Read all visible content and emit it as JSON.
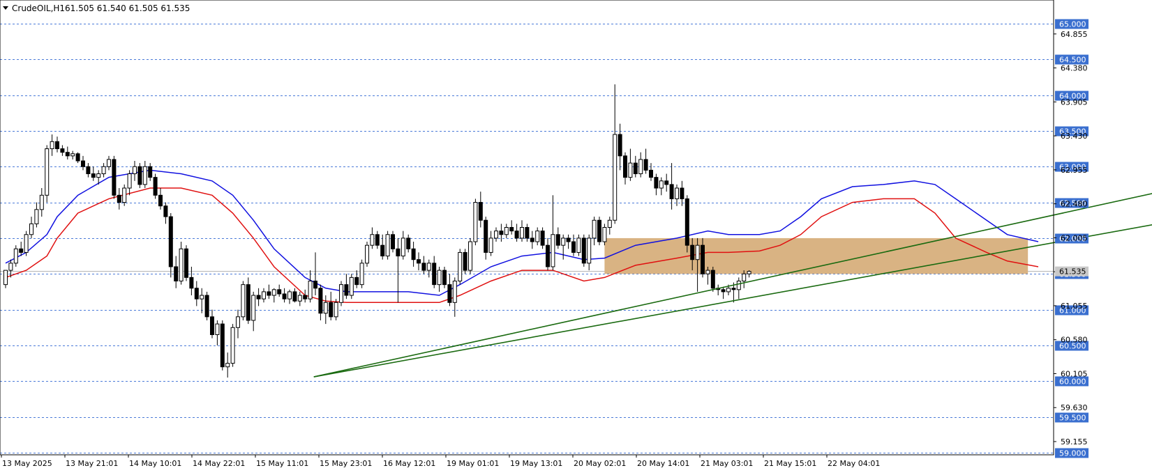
{
  "header": {
    "symbol_title": "CrudeOIL,H1",
    "ohlc": "61.505 61.540 61.505 61.535",
    "menu_icon": "triangle-down-icon"
  },
  "colors": {
    "background": "#ffffff",
    "grid_dashed": "#4a7ad8",
    "candle_up_fill": "#ffffff",
    "candle_down_fill": "#000000",
    "candle_outline": "#000000",
    "ma_fast": "#1010e0",
    "ma_slow": "#e01010",
    "trendline": "#1a6a10",
    "zone_fill": "#d9b383",
    "level_label_bg": "#3a6fcf",
    "price_tag_bg": "#c8c8c8"
  },
  "chart_data": {
    "type": "candlestick",
    "symbol": "CrudeOIL",
    "timeframe": "H1",
    "ylim": [
      58.97,
      65.33
    ],
    "price_axis_ticks": [
      "64.855",
      "64.380",
      "63.905",
      "63.430",
      "62.955",
      "62.480",
      "62.005",
      "61.530",
      "61.055",
      "60.580",
      "60.105",
      "59.630",
      "59.155"
    ],
    "levels": [
      "65.000",
      "64.500",
      "64.000",
      "63.500",
      "63.000",
      "62.500",
      "62.000",
      "61.500",
      "61.000",
      "60.500",
      "60.000",
      "59.500",
      "59.000"
    ],
    "current_price_tag": "61.535",
    "time_labels": [
      "13 May 2025",
      "13 May 21:01",
      "14 May 10:01",
      "14 May 22:01",
      "15 May 11:01",
      "15 May 23:01",
      "16 May 12:01",
      "19 May 01:01",
      "19 May 13:01",
      "20 May 02:01",
      "20 May 14:01",
      "21 May 03:01",
      "21 May 15:01",
      "22 May 04:01"
    ],
    "candles": [
      [
        61.35,
        61.55,
        61.3,
        61.55
      ],
      [
        61.55,
        61.7,
        61.45,
        61.65
      ],
      [
        61.65,
        61.9,
        61.6,
        61.85
      ],
      [
        61.85,
        61.95,
        61.75,
        61.8
      ],
      [
        61.8,
        62.1,
        61.75,
        62.05
      ],
      [
        62.05,
        62.3,
        62.0,
        62.2
      ],
      [
        62.2,
        62.5,
        62.15,
        62.4
      ],
      [
        62.4,
        62.7,
        62.3,
        62.6
      ],
      [
        62.6,
        63.3,
        62.5,
        63.25
      ],
      [
        63.25,
        63.45,
        63.15,
        63.35
      ],
      [
        63.35,
        63.42,
        63.2,
        63.25
      ],
      [
        63.25,
        63.3,
        63.15,
        63.2
      ],
      [
        63.2,
        63.28,
        63.1,
        63.15
      ],
      [
        63.15,
        63.22,
        63.1,
        63.18
      ],
      [
        63.18,
        63.2,
        63.05,
        63.08
      ],
      [
        63.08,
        63.15,
        62.95,
        63.0
      ],
      [
        63.0,
        63.05,
        62.85,
        62.9
      ],
      [
        62.9,
        63.0,
        62.8,
        62.85
      ],
      [
        62.85,
        62.95,
        62.75,
        62.9
      ],
      [
        62.9,
        63.05,
        62.85,
        63.0
      ],
      [
        63.0,
        63.15,
        62.95,
        63.1
      ],
      [
        63.1,
        63.15,
        62.55,
        62.6
      ],
      [
        62.6,
        62.7,
        62.4,
        62.5
      ],
      [
        62.5,
        62.75,
        62.45,
        62.7
      ],
      [
        62.7,
        62.95,
        62.6,
        62.9
      ],
      [
        62.9,
        63.08,
        62.8,
        63.0
      ],
      [
        63.0,
        63.05,
        62.7,
        62.75
      ],
      [
        62.75,
        63.08,
        62.7,
        63.0
      ],
      [
        63.0,
        63.05,
        62.8,
        62.85
      ],
      [
        62.85,
        62.9,
        62.55,
        62.6
      ],
      [
        62.6,
        62.7,
        62.4,
        62.45
      ],
      [
        62.45,
        62.5,
        62.2,
        62.3
      ],
      [
        62.3,
        62.35,
        61.45,
        61.6
      ],
      [
        61.6,
        61.75,
        61.3,
        61.4
      ],
      [
        61.4,
        61.95,
        61.35,
        61.85
      ],
      [
        61.85,
        61.9,
        61.4,
        61.45
      ],
      [
        61.45,
        61.6,
        61.2,
        61.3
      ],
      [
        61.3,
        61.4,
        61.05,
        61.15
      ],
      [
        61.15,
        61.3,
        60.95,
        61.2
      ],
      [
        61.2,
        61.25,
        60.85,
        60.9
      ],
      [
        60.9,
        61.0,
        60.6,
        60.65
      ],
      [
        60.65,
        60.85,
        60.5,
        60.8
      ],
      [
        60.8,
        60.85,
        60.15,
        60.2
      ],
      [
        60.2,
        60.4,
        60.05,
        60.25
      ],
      [
        60.25,
        60.8,
        60.2,
        60.75
      ],
      [
        60.75,
        61.0,
        60.6,
        60.9
      ],
      [
        60.9,
        61.4,
        60.85,
        61.35
      ],
      [
        61.35,
        61.45,
        60.8,
        60.85
      ],
      [
        60.85,
        61.25,
        60.7,
        61.2
      ],
      [
        61.2,
        61.3,
        61.05,
        61.15
      ],
      [
        61.15,
        61.3,
        61.1,
        61.25
      ],
      [
        61.25,
        61.35,
        61.15,
        61.2
      ],
      [
        61.2,
        61.3,
        61.1,
        61.28
      ],
      [
        61.28,
        61.35,
        61.18,
        61.22
      ],
      [
        61.22,
        61.3,
        61.1,
        61.15
      ],
      [
        61.15,
        61.28,
        61.08,
        61.25
      ],
      [
        61.25,
        61.3,
        61.1,
        61.12
      ],
      [
        61.12,
        61.25,
        61.05,
        61.2
      ],
      [
        61.2,
        61.28,
        61.1,
        61.15
      ],
      [
        61.15,
        61.55,
        61.1,
        61.4
      ],
      [
        61.4,
        61.8,
        61.2,
        61.3
      ],
      [
        61.3,
        61.35,
        60.85,
        60.95
      ],
      [
        60.95,
        61.2,
        60.8,
        61.1
      ],
      [
        61.1,
        61.25,
        60.85,
        60.9
      ],
      [
        60.9,
        61.15,
        60.85,
        61.1
      ],
      [
        61.1,
        61.4,
        61.05,
        61.35
      ],
      [
        61.35,
        61.5,
        61.15,
        61.2
      ],
      [
        61.2,
        61.5,
        61.15,
        61.45
      ],
      [
        61.45,
        61.55,
        61.3,
        61.35
      ],
      [
        61.35,
        61.7,
        61.3,
        61.65
      ],
      [
        61.65,
        61.95,
        61.6,
        61.9
      ],
      [
        61.9,
        62.15,
        61.85,
        62.05
      ],
      [
        62.05,
        62.1,
        61.85,
        61.9
      ],
      [
        61.9,
        62.05,
        61.7,
        61.75
      ],
      [
        61.75,
        62.1,
        61.7,
        62.05
      ],
      [
        62.05,
        62.1,
        61.8,
        61.85
      ],
      [
        61.85,
        62.0,
        61.1,
        61.75
      ],
      [
        61.75,
        62.1,
        61.7,
        62.0
      ],
      [
        62.0,
        62.05,
        61.8,
        61.85
      ],
      [
        61.85,
        61.95,
        61.6,
        61.7
      ],
      [
        61.7,
        61.8,
        61.55,
        61.65
      ],
      [
        61.65,
        61.75,
        61.5,
        61.55
      ],
      [
        61.55,
        61.7,
        61.45,
        61.65
      ],
      [
        61.65,
        61.75,
        61.3,
        61.35
      ],
      [
        61.35,
        61.6,
        61.25,
        61.55
      ],
      [
        61.55,
        61.6,
        61.3,
        61.35
      ],
      [
        61.35,
        61.5,
        61.05,
        61.1
      ],
      [
        61.1,
        61.45,
        60.9,
        61.4
      ],
      [
        61.4,
        61.85,
        61.35,
        61.8
      ],
      [
        61.8,
        61.85,
        61.5,
        61.55
      ],
      [
        61.55,
        62.0,
        61.5,
        61.95
      ],
      [
        61.95,
        62.55,
        61.9,
        62.5
      ],
      [
        62.5,
        62.65,
        62.15,
        62.25
      ],
      [
        62.25,
        62.3,
        61.7,
        61.8
      ],
      [
        61.8,
        62.1,
        61.75,
        62.0
      ],
      [
        62.0,
        62.15,
        61.95,
        62.1
      ],
      [
        62.1,
        62.2,
        61.95,
        62.05
      ],
      [
        62.05,
        62.2,
        62.0,
        62.15
      ],
      [
        62.15,
        62.25,
        62.05,
        62.1
      ],
      [
        62.1,
        62.2,
        61.95,
        62.0
      ],
      [
        62.0,
        62.25,
        61.95,
        62.15
      ],
      [
        62.15,
        62.2,
        61.95,
        62.0
      ],
      [
        62.0,
        62.1,
        61.85,
        61.95
      ],
      [
        61.95,
        62.15,
        61.9,
        62.1
      ],
      [
        62.1,
        62.15,
        61.85,
        61.9
      ],
      [
        61.9,
        62.0,
        61.55,
        61.6
      ],
      [
        61.6,
        62.6,
        61.55,
        62.05
      ],
      [
        62.05,
        62.15,
        61.85,
        61.9
      ],
      [
        61.9,
        62.05,
        61.7,
        62.0
      ],
      [
        62.0,
        62.05,
        61.85,
        61.95
      ],
      [
        61.95,
        62.05,
        61.75,
        61.8
      ],
      [
        61.8,
        62.05,
        61.75,
        62.0
      ],
      [
        62.0,
        62.05,
        61.6,
        61.65
      ],
      [
        61.65,
        62.05,
        61.55,
        62.0
      ],
      [
        62.0,
        62.3,
        61.9,
        62.25
      ],
      [
        62.25,
        62.3,
        61.9,
        61.95
      ],
      [
        61.95,
        62.2,
        61.9,
        62.15
      ],
      [
        62.15,
        62.3,
        62.05,
        62.25
      ],
      [
        62.25,
        64.15,
        62.2,
        63.45
      ],
      [
        63.45,
        63.6,
        62.95,
        63.15
      ],
      [
        63.15,
        63.2,
        62.75,
        62.85
      ],
      [
        62.85,
        63.25,
        62.8,
        63.05
      ],
      [
        63.05,
        63.15,
        62.85,
        62.9
      ],
      [
        62.9,
        63.2,
        62.85,
        63.1
      ],
      [
        63.1,
        63.25,
        62.9,
        62.95
      ],
      [
        62.95,
        63.05,
        62.8,
        62.85
      ],
      [
        62.85,
        62.9,
        62.6,
        62.7
      ],
      [
        62.7,
        62.85,
        62.6,
        62.8
      ],
      [
        62.8,
        62.9,
        62.65,
        62.75
      ],
      [
        62.75,
        63.05,
        62.4,
        62.55
      ],
      [
        62.55,
        62.75,
        62.45,
        62.7
      ],
      [
        62.7,
        62.8,
        62.45,
        62.55
      ],
      [
        62.55,
        62.6,
        61.8,
        61.9
      ],
      [
        61.9,
        62.0,
        61.55,
        61.7
      ],
      [
        61.7,
        62.0,
        61.25,
        61.9
      ],
      [
        61.9,
        62.0,
        61.45,
        61.5
      ],
      [
        61.5,
        61.6,
        61.35,
        61.55
      ],
      [
        61.55,
        61.6,
        61.25,
        61.3
      ],
      [
        61.3,
        61.35,
        61.2,
        61.28
      ],
      [
        61.28,
        61.32,
        61.15,
        61.25
      ],
      [
        61.25,
        61.35,
        61.2,
        61.3
      ],
      [
        61.3,
        61.38,
        61.1,
        61.28
      ],
      [
        61.28,
        61.45,
        61.15,
        61.4
      ],
      [
        61.4,
        61.55,
        61.3,
        61.5
      ],
      [
        61.5,
        61.55,
        61.45,
        61.535
      ]
    ],
    "ma_fast": [
      [
        0,
        61.65
      ],
      [
        4,
        61.8
      ],
      [
        8,
        62.05
      ],
      [
        10,
        62.3
      ],
      [
        14,
        62.6
      ],
      [
        20,
        62.85
      ],
      [
        28,
        62.95
      ],
      [
        34,
        62.9
      ],
      [
        40,
        62.8
      ],
      [
        44,
        62.6
      ],
      [
        48,
        62.25
      ],
      [
        52,
        61.85
      ],
      [
        58,
        61.45
      ],
      [
        62,
        61.3
      ],
      [
        66,
        61.25
      ],
      [
        72,
        61.25
      ],
      [
        78,
        61.25
      ],
      [
        84,
        61.2
      ],
      [
        88,
        61.35
      ],
      [
        94,
        61.6
      ],
      [
        100,
        61.75
      ],
      [
        106,
        61.8
      ],
      [
        112,
        61.7
      ],
      [
        116,
        61.72
      ],
      [
        122,
        61.9
      ],
      [
        130,
        62.0
      ],
      [
        136,
        62.1
      ],
      [
        140,
        62.05
      ],
      [
        146,
        62.05
      ],
      [
        150,
        62.1
      ],
      [
        154,
        62.3
      ],
      [
        158,
        62.55
      ],
      [
        164,
        62.72
      ],
      [
        170,
        62.75
      ],
      [
        176,
        62.8
      ],
      [
        180,
        62.75
      ],
      [
        184,
        62.55
      ],
      [
        190,
        62.25
      ],
      [
        194,
        62.05
      ],
      [
        200,
        61.95
      ]
    ],
    "ma_slow": [
      [
        0,
        61.45
      ],
      [
        4,
        61.55
      ],
      [
        8,
        61.75
      ],
      [
        10,
        62.0
      ],
      [
        14,
        62.35
      ],
      [
        20,
        62.55
      ],
      [
        28,
        62.7
      ],
      [
        34,
        62.7
      ],
      [
        40,
        62.6
      ],
      [
        44,
        62.35
      ],
      [
        48,
        62.0
      ],
      [
        52,
        61.6
      ],
      [
        58,
        61.2
      ],
      [
        62,
        61.12
      ],
      [
        66,
        61.1
      ],
      [
        72,
        61.1
      ],
      [
        78,
        61.1
      ],
      [
        84,
        61.1
      ],
      [
        88,
        61.2
      ],
      [
        94,
        61.4
      ],
      [
        100,
        61.55
      ],
      [
        106,
        61.55
      ],
      [
        112,
        61.4
      ],
      [
        116,
        61.45
      ],
      [
        122,
        61.62
      ],
      [
        130,
        61.72
      ],
      [
        136,
        61.8
      ],
      [
        140,
        61.8
      ],
      [
        146,
        61.82
      ],
      [
        150,
        61.9
      ],
      [
        154,
        62.05
      ],
      [
        158,
        62.3
      ],
      [
        164,
        62.5
      ],
      [
        170,
        62.55
      ],
      [
        176,
        62.55
      ],
      [
        180,
        62.35
      ],
      [
        184,
        62.0
      ],
      [
        190,
        61.8
      ],
      [
        194,
        61.68
      ],
      [
        200,
        61.6
      ]
    ],
    "trendlines": [
      {
        "p1": [
          59.7,
          60.06
        ],
        "p2": [
          275,
          63.46
        ]
      },
      {
        "p1": [
          59.7,
          60.06
        ],
        "p2": [
          275,
          62.88
        ]
      }
    ],
    "zone": {
      "x_from": 116,
      "x_to": 198,
      "y_from": 61.5,
      "y_to": 62.0
    }
  }
}
